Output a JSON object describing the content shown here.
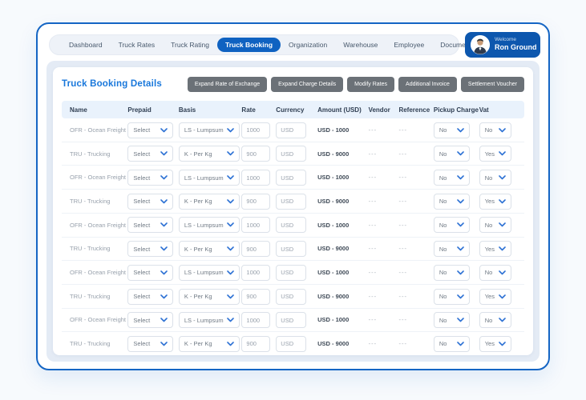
{
  "colors": {
    "accent": "#0F62C1",
    "card_border": "#1465C4",
    "badge_background": "#0D57AE",
    "title_blue": "#1877DB",
    "button_gray": "#6B7177",
    "chevron_blue": "#2E72D4",
    "header_row_background": "#E9F2FC",
    "content_background": "#E4EBF5"
  },
  "nav": {
    "items": [
      {
        "label": "Dashboard",
        "active": false
      },
      {
        "label": "Truck Rates",
        "active": false
      },
      {
        "label": "Truck Rating",
        "active": false
      },
      {
        "label": "Truck Booking",
        "active": true
      },
      {
        "label": "Organization",
        "active": false
      },
      {
        "label": "Warehouse",
        "active": false
      },
      {
        "label": "Employee",
        "active": false
      },
      {
        "label": "Documents",
        "active": false
      }
    ],
    "welcome": {
      "greeting": "Welcome",
      "name": "Ron Ground"
    }
  },
  "toolbar": {
    "title": "Truck Booking Details",
    "buttons": [
      "Expand Rate of Exchange",
      "Expand Charge Details",
      "Modify Rates",
      "Additional Invoice",
      "Settlement Voucher"
    ]
  },
  "table": {
    "columns": [
      "Name",
      "Prepaid",
      "Basis",
      "Rate",
      "Currency",
      "Amount (USD)",
      "Vendor",
      "Reference",
      "Pickup Charge",
      "Vat"
    ],
    "rows": [
      {
        "name": "OFR - Ocean Freight",
        "prepaid": "Select",
        "basis": "LS - Lumpsum",
        "rate": "1000",
        "currency": "USD",
        "amount": "USD - 1000",
        "vendor": "---",
        "reference": "---",
        "pickup": "No",
        "vat": "No"
      },
      {
        "name": "TRU - Trucking",
        "prepaid": "Select",
        "basis": "K - Per Kg",
        "rate": "900",
        "currency": "USD",
        "amount": "USD - 9000",
        "vendor": "---",
        "reference": "---",
        "pickup": "No",
        "vat": "Yes"
      },
      {
        "name": "OFR - Ocean Freight",
        "prepaid": "Select",
        "basis": "LS - Lumpsum",
        "rate": "1000",
        "currency": "USD",
        "amount": "USD - 1000",
        "vendor": "---",
        "reference": "---",
        "pickup": "No",
        "vat": "No"
      },
      {
        "name": "TRU - Trucking",
        "prepaid": "Select",
        "basis": "K - Per Kg",
        "rate": "900",
        "currency": "USD",
        "amount": "USD - 9000",
        "vendor": "---",
        "reference": "---",
        "pickup": "No",
        "vat": "Yes"
      },
      {
        "name": "OFR - Ocean Freight",
        "prepaid": "Select",
        "basis": "LS - Lumpsum",
        "rate": "1000",
        "currency": "USD",
        "amount": "USD - 1000",
        "vendor": "---",
        "reference": "---",
        "pickup": "No",
        "vat": "No"
      },
      {
        "name": "TRU - Trucking",
        "prepaid": "Select",
        "basis": "K - Per Kg",
        "rate": "900",
        "currency": "USD",
        "amount": "USD - 9000",
        "vendor": "---",
        "reference": "---",
        "pickup": "No",
        "vat": "Yes"
      },
      {
        "name": "OFR - Ocean Freight",
        "prepaid": "Select",
        "basis": "LS - Lumpsum",
        "rate": "1000",
        "currency": "USD",
        "amount": "USD - 1000",
        "vendor": "---",
        "reference": "---",
        "pickup": "No",
        "vat": "No"
      },
      {
        "name": "TRU - Trucking",
        "prepaid": "Select",
        "basis": "K - Per Kg",
        "rate": "900",
        "currency": "USD",
        "amount": "USD - 9000",
        "vendor": "---",
        "reference": "---",
        "pickup": "No",
        "vat": "Yes"
      },
      {
        "name": "OFR - Ocean Freight",
        "prepaid": "Select",
        "basis": "LS - Lumpsum",
        "rate": "1000",
        "currency": "USD",
        "amount": "USD - 1000",
        "vendor": "---",
        "reference": "---",
        "pickup": "No",
        "vat": "No"
      },
      {
        "name": "TRU - Trucking",
        "prepaid": "Select",
        "basis": "K - Per Kg",
        "rate": "900",
        "currency": "USD",
        "amount": "USD - 9000",
        "vendor": "---",
        "reference": "---",
        "pickup": "No",
        "vat": "Yes"
      }
    ]
  }
}
